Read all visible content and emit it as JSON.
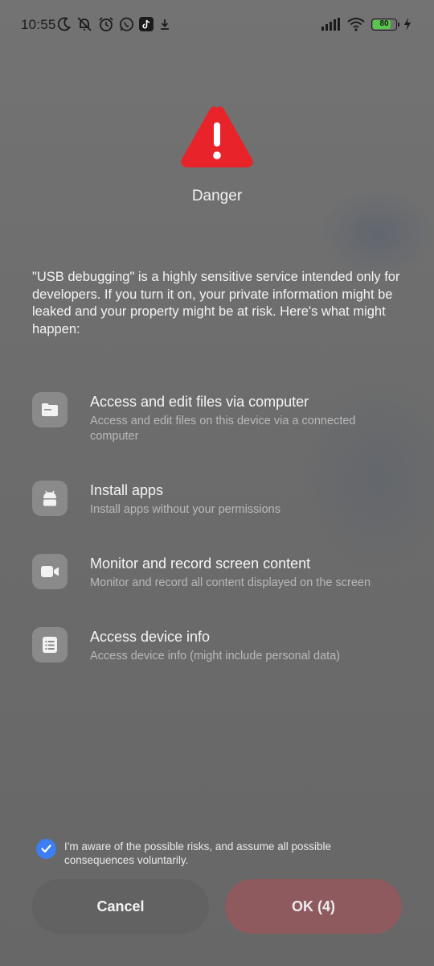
{
  "status_bar": {
    "time": "10:55",
    "battery_level": "80",
    "icons_left": [
      "moon-icon",
      "notifications-off-icon",
      "alarm-icon",
      "whatsapp-icon",
      "tiktok-icon",
      "download-icon"
    ],
    "icons_right": [
      "signal-icon",
      "wifi-icon",
      "battery-icon",
      "charging-icon"
    ]
  },
  "header": {
    "title": "Danger",
    "icon": "warning-triangle-icon",
    "icon_color": "#e8232a"
  },
  "intro_text": "\"USB debugging\" is a highly sensitive service intended only for developers. If you turn it on, your private information might be leaked and your property might be at risk. Here's what might happen:",
  "risks": [
    {
      "icon": "folder-icon",
      "title": "Access and edit files via computer",
      "description": "Access and edit files on this device via a connected computer"
    },
    {
      "icon": "android-icon",
      "title": "Install apps",
      "description": "Install apps without your permissions"
    },
    {
      "icon": "video-camera-icon",
      "title": "Monitor and record screen content",
      "description": "Monitor and record all content displayed on the screen"
    },
    {
      "icon": "device-info-icon",
      "title": "Access device info",
      "description": "Access device info (might include personal data)"
    }
  ],
  "consent": {
    "checked": true,
    "text": "I'm aware of the possible risks, and assume all possible consequences voluntarily."
  },
  "buttons": {
    "cancel_label": "Cancel",
    "ok_label": "OK (4)"
  },
  "colors": {
    "accent_blue": "#3e7df2",
    "danger_red": "#e8232a",
    "ok_button": "#8f5a5e"
  }
}
